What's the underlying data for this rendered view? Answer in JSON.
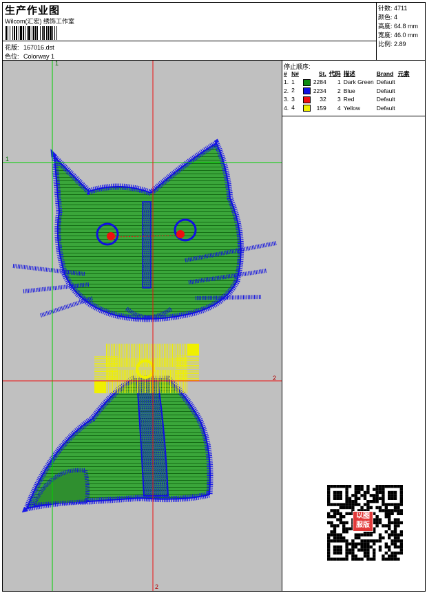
{
  "header": {
    "title": "生产作业图",
    "subtitle": "Wilcom(汇宏) 绣饰工作室",
    "design_label": "花版:",
    "design_file": "167016.dst",
    "colorway_label": "色位:",
    "colorway": "Colorway 1"
  },
  "stats": [
    {
      "label": "针数:",
      "value": "4711"
    },
    {
      "label": "颜色:",
      "value": "4"
    },
    {
      "label": "高度:",
      "value": "64.8 mm"
    },
    {
      "label": "宽度:",
      "value": "46.0 mm"
    },
    {
      "label": "比例:",
      "value": "2.89"
    }
  ],
  "stop_sequence": {
    "title": "停止顺序:",
    "headers": [
      "#",
      "N#",
      "St.",
      "代码",
      "描述",
      "Brand",
      "元素"
    ],
    "rows": [
      {
        "num": "1.",
        "n": "1",
        "color": "#0e8a12",
        "stitches": "2284",
        "code": "1",
        "desc": "Dark Green",
        "brand": "Default"
      },
      {
        "num": "2.",
        "n": "2",
        "color": "#1010e0",
        "stitches": "2234",
        "code": "2",
        "desc": "Blue",
        "brand": "Default"
      },
      {
        "num": "3.",
        "n": "3",
        "color": "#ee1010",
        "stitches": "32",
        "code": "3",
        "desc": "Red",
        "brand": "Default"
      },
      {
        "num": "4.",
        "n": "4",
        "color": "#f0f000",
        "stitches": "159",
        "code": "4",
        "desc": "Yellow",
        "brand": "Default"
      }
    ]
  },
  "guides": {
    "v1": "1",
    "h1": "1",
    "h2": "2",
    "v2": "2"
  },
  "qr_stamp": [
    "以图",
    "服版"
  ]
}
